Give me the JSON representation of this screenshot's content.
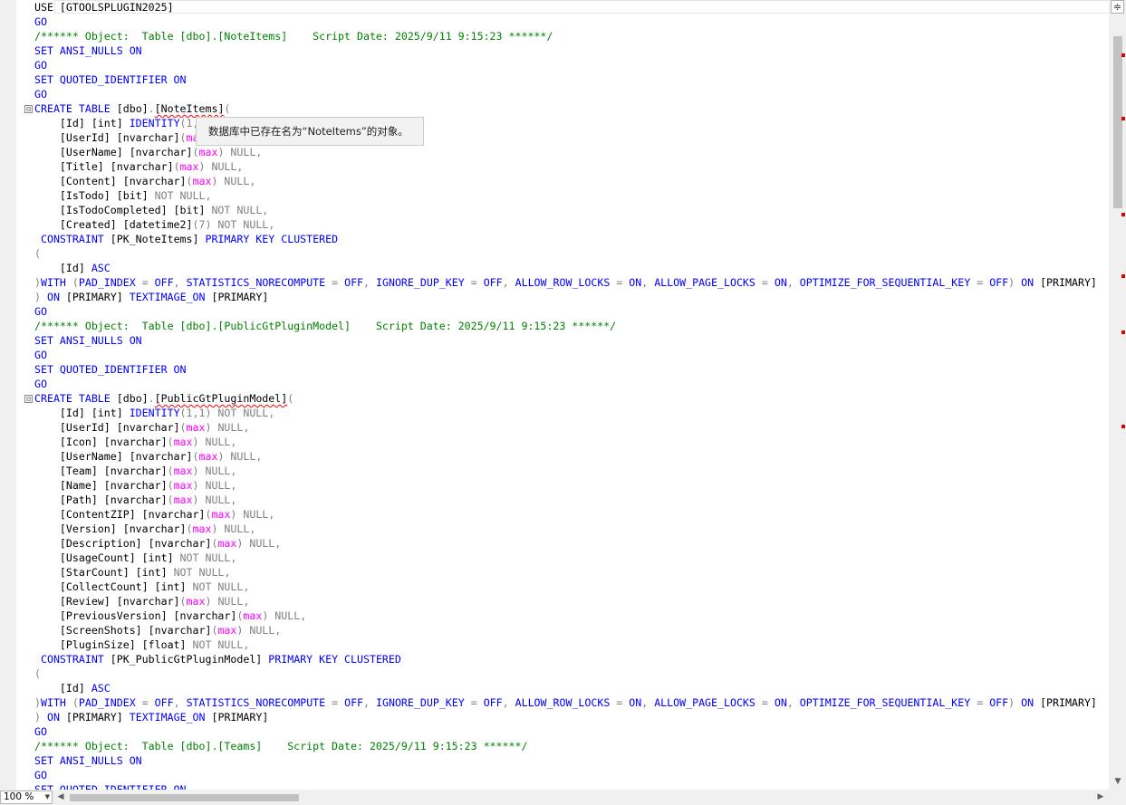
{
  "editor": {
    "lines": [
      [
        {
          "t": "USE [GTOOLSPLUGIN2025]"
        }
      ],
      [
        {
          "t": "GO",
          "c": "kw"
        }
      ],
      [
        {
          "t": "/****** Object:  Table [dbo].[NoteItems]    Script Date: 2025/9/11 9:15:23 ******/",
          "c": "cm"
        }
      ],
      [
        {
          "t": "SET ANSI_NULLS ON",
          "c": "kw"
        }
      ],
      [
        {
          "t": "GO",
          "c": "kw"
        }
      ],
      [
        {
          "t": "SET QUOTED_IDENTIFIER ON",
          "c": "kw"
        }
      ],
      [
        {
          "t": "GO",
          "c": "kw"
        }
      ],
      [
        {
          "t": "CREATE TABLE ",
          "c": "kw"
        },
        {
          "t": "[dbo]"
        },
        {
          "t": ".",
          "c": "gr"
        },
        {
          "t": "[NoteItems]",
          "c": "squig"
        },
        {
          "t": "(",
          "c": "gr"
        }
      ],
      [
        {
          "t": "    [Id] [int] "
        },
        {
          "t": "IDENTITY",
          "c": "kw"
        },
        {
          "t": "(1,",
          "c": "gr"
        }
      ],
      [
        {
          "t": "    [UserId] [nvarchar]"
        },
        {
          "t": "(",
          "c": "gr"
        },
        {
          "t": "max",
          "c": "fn"
        }
      ],
      [
        {
          "t": "    [UserName] [nvarchar]"
        },
        {
          "t": "(",
          "c": "gr"
        },
        {
          "t": "max",
          "c": "fn"
        },
        {
          "t": ") NULL,",
          "c": "gr"
        }
      ],
      [
        {
          "t": "    [Title] [nvarchar]"
        },
        {
          "t": "(",
          "c": "gr"
        },
        {
          "t": "max",
          "c": "fn"
        },
        {
          "t": ") NULL,",
          "c": "gr"
        }
      ],
      [
        {
          "t": "    [Content] [nvarchar]"
        },
        {
          "t": "(",
          "c": "gr"
        },
        {
          "t": "max",
          "c": "fn"
        },
        {
          "t": ") NULL,",
          "c": "gr"
        }
      ],
      [
        {
          "t": "    [IsTodo] [bit] "
        },
        {
          "t": "NOT NULL,",
          "c": "gr"
        }
      ],
      [
        {
          "t": "    [IsTodoCompleted] [bit] "
        },
        {
          "t": "NOT NULL,",
          "c": "gr"
        }
      ],
      [
        {
          "t": "    [Created] [datetime2]"
        },
        {
          "t": "(7) NOT NULL,",
          "c": "gr"
        }
      ],
      [
        {
          "t": " CONSTRAINT ",
          "c": "kw"
        },
        {
          "t": "[PK_NoteItems] "
        },
        {
          "t": "PRIMARY KEY CLUSTERED",
          "c": "kw"
        }
      ],
      [
        {
          "t": "(",
          "c": "gr"
        }
      ],
      [
        {
          "t": "    [Id] "
        },
        {
          "t": "ASC",
          "c": "kw"
        }
      ],
      [
        {
          "t": ")",
          "c": "gr"
        },
        {
          "t": "WITH ",
          "c": "kw"
        },
        {
          "t": "(",
          "c": "gr"
        },
        {
          "t": "PAD_INDEX ",
          "c": "kw"
        },
        {
          "t": "= ",
          "c": "gr"
        },
        {
          "t": "OFF",
          "c": "kw"
        },
        {
          "t": ", ",
          "c": "gr"
        },
        {
          "t": "STATISTICS_NORECOMPUTE ",
          "c": "kw"
        },
        {
          "t": "= ",
          "c": "gr"
        },
        {
          "t": "OFF",
          "c": "kw"
        },
        {
          "t": ", ",
          "c": "gr"
        },
        {
          "t": "IGNORE_DUP_KEY ",
          "c": "kw"
        },
        {
          "t": "= ",
          "c": "gr"
        },
        {
          "t": "OFF",
          "c": "kw"
        },
        {
          "t": ", ",
          "c": "gr"
        },
        {
          "t": "ALLOW_ROW_LOCKS ",
          "c": "kw"
        },
        {
          "t": "= ",
          "c": "gr"
        },
        {
          "t": "ON",
          "c": "kw"
        },
        {
          "t": ", ",
          "c": "gr"
        },
        {
          "t": "ALLOW_PAGE_LOCKS ",
          "c": "kw"
        },
        {
          "t": "= ",
          "c": "gr"
        },
        {
          "t": "ON",
          "c": "kw"
        },
        {
          "t": ", ",
          "c": "gr"
        },
        {
          "t": "OPTIMIZE_FOR_SEQUENTIAL_KEY ",
          "c": "kw"
        },
        {
          "t": "= ",
          "c": "gr"
        },
        {
          "t": "OFF",
          "c": "kw"
        },
        {
          "t": ") ",
          "c": "gr"
        },
        {
          "t": "ON ",
          "c": "kw"
        },
        {
          "t": "[PRIMARY]"
        }
      ],
      [
        {
          "t": ") ",
          "c": "gr"
        },
        {
          "t": "ON ",
          "c": "kw"
        },
        {
          "t": "[PRIMARY] "
        },
        {
          "t": "TEXTIMAGE_ON ",
          "c": "kw"
        },
        {
          "t": "[PRIMARY]"
        }
      ],
      [
        {
          "t": "GO",
          "c": "kw"
        }
      ],
      [
        {
          "t": "/****** Object:  Table [dbo].[PublicGtPluginModel]    Script Date: 2025/9/11 9:15:23 ******/",
          "c": "cm"
        }
      ],
      [
        {
          "t": "SET ANSI_NULLS ON",
          "c": "kw"
        }
      ],
      [
        {
          "t": "GO",
          "c": "kw"
        }
      ],
      [
        {
          "t": "SET QUOTED_IDENTIFIER ON",
          "c": "kw"
        }
      ],
      [
        {
          "t": "GO",
          "c": "kw"
        }
      ],
      [
        {
          "t": "CREATE TABLE ",
          "c": "kw"
        },
        {
          "t": "[dbo]"
        },
        {
          "t": ".",
          "c": "gr"
        },
        {
          "t": "[PublicGtPluginModel]",
          "c": "squig"
        },
        {
          "t": "(",
          "c": "gr"
        }
      ],
      [
        {
          "t": "    [Id] [int] "
        },
        {
          "t": "IDENTITY",
          "c": "kw"
        },
        {
          "t": "(1,1) NOT NULL,",
          "c": "gr"
        }
      ],
      [
        {
          "t": "    [UserId] [nvarchar]"
        },
        {
          "t": "(",
          "c": "gr"
        },
        {
          "t": "max",
          "c": "fn"
        },
        {
          "t": ") NULL,",
          "c": "gr"
        }
      ],
      [
        {
          "t": "    [Icon] [nvarchar]"
        },
        {
          "t": "(",
          "c": "gr"
        },
        {
          "t": "max",
          "c": "fn"
        },
        {
          "t": ") NULL,",
          "c": "gr"
        }
      ],
      [
        {
          "t": "    [UserName] [nvarchar]"
        },
        {
          "t": "(",
          "c": "gr"
        },
        {
          "t": "max",
          "c": "fn"
        },
        {
          "t": ") NULL,",
          "c": "gr"
        }
      ],
      [
        {
          "t": "    [Team] [nvarchar]"
        },
        {
          "t": "(",
          "c": "gr"
        },
        {
          "t": "max",
          "c": "fn"
        },
        {
          "t": ") NULL,",
          "c": "gr"
        }
      ],
      [
        {
          "t": "    [Name] [nvarchar]"
        },
        {
          "t": "(",
          "c": "gr"
        },
        {
          "t": "max",
          "c": "fn"
        },
        {
          "t": ") NULL,",
          "c": "gr"
        }
      ],
      [
        {
          "t": "    [Path] [nvarchar]"
        },
        {
          "t": "(",
          "c": "gr"
        },
        {
          "t": "max",
          "c": "fn"
        },
        {
          "t": ") NULL,",
          "c": "gr"
        }
      ],
      [
        {
          "t": "    [ContentZIP] [nvarchar]"
        },
        {
          "t": "(",
          "c": "gr"
        },
        {
          "t": "max",
          "c": "fn"
        },
        {
          "t": ") NULL,",
          "c": "gr"
        }
      ],
      [
        {
          "t": "    [Version] [nvarchar]"
        },
        {
          "t": "(",
          "c": "gr"
        },
        {
          "t": "max",
          "c": "fn"
        },
        {
          "t": ") NULL,",
          "c": "gr"
        }
      ],
      [
        {
          "t": "    [Description] [nvarchar]"
        },
        {
          "t": "(",
          "c": "gr"
        },
        {
          "t": "max",
          "c": "fn"
        },
        {
          "t": ") NULL,",
          "c": "gr"
        }
      ],
      [
        {
          "t": "    [UsageCount] [int] "
        },
        {
          "t": "NOT NULL,",
          "c": "gr"
        }
      ],
      [
        {
          "t": "    [StarCount] [int] "
        },
        {
          "t": "NOT NULL,",
          "c": "gr"
        }
      ],
      [
        {
          "t": "    [CollectCount] [int] "
        },
        {
          "t": "NOT NULL,",
          "c": "gr"
        }
      ],
      [
        {
          "t": "    [Review] [nvarchar]"
        },
        {
          "t": "(",
          "c": "gr"
        },
        {
          "t": "max",
          "c": "fn"
        },
        {
          "t": ") NULL,",
          "c": "gr"
        }
      ],
      [
        {
          "t": "    [PreviousVersion] [nvarchar]"
        },
        {
          "t": "(",
          "c": "gr"
        },
        {
          "t": "max",
          "c": "fn"
        },
        {
          "t": ") NULL,",
          "c": "gr"
        }
      ],
      [
        {
          "t": "    [ScreenShots] [nvarchar]"
        },
        {
          "t": "(",
          "c": "gr"
        },
        {
          "t": "max",
          "c": "fn"
        },
        {
          "t": ") NULL,",
          "c": "gr"
        }
      ],
      [
        {
          "t": "    [PluginSize] [float] "
        },
        {
          "t": "NOT NULL,",
          "c": "gr"
        }
      ],
      [
        {
          "t": " CONSTRAINT ",
          "c": "kw"
        },
        {
          "t": "[PK_PublicGtPluginModel] "
        },
        {
          "t": "PRIMARY KEY CLUSTERED",
          "c": "kw"
        }
      ],
      [
        {
          "t": "(",
          "c": "gr"
        }
      ],
      [
        {
          "t": "    [Id] "
        },
        {
          "t": "ASC",
          "c": "kw"
        }
      ],
      [
        {
          "t": ")",
          "c": "gr"
        },
        {
          "t": "WITH ",
          "c": "kw"
        },
        {
          "t": "(",
          "c": "gr"
        },
        {
          "t": "PAD_INDEX ",
          "c": "kw"
        },
        {
          "t": "= ",
          "c": "gr"
        },
        {
          "t": "OFF",
          "c": "kw"
        },
        {
          "t": ", ",
          "c": "gr"
        },
        {
          "t": "STATISTICS_NORECOMPUTE ",
          "c": "kw"
        },
        {
          "t": "= ",
          "c": "gr"
        },
        {
          "t": "OFF",
          "c": "kw"
        },
        {
          "t": ", ",
          "c": "gr"
        },
        {
          "t": "IGNORE_DUP_KEY ",
          "c": "kw"
        },
        {
          "t": "= ",
          "c": "gr"
        },
        {
          "t": "OFF",
          "c": "kw"
        },
        {
          "t": ", ",
          "c": "gr"
        },
        {
          "t": "ALLOW_ROW_LOCKS ",
          "c": "kw"
        },
        {
          "t": "= ",
          "c": "gr"
        },
        {
          "t": "ON",
          "c": "kw"
        },
        {
          "t": ", ",
          "c": "gr"
        },
        {
          "t": "ALLOW_PAGE_LOCKS ",
          "c": "kw"
        },
        {
          "t": "= ",
          "c": "gr"
        },
        {
          "t": "ON",
          "c": "kw"
        },
        {
          "t": ", ",
          "c": "gr"
        },
        {
          "t": "OPTIMIZE_FOR_SEQUENTIAL_KEY ",
          "c": "kw"
        },
        {
          "t": "= ",
          "c": "gr"
        },
        {
          "t": "OFF",
          "c": "kw"
        },
        {
          "t": ") ",
          "c": "gr"
        },
        {
          "t": "ON ",
          "c": "kw"
        },
        {
          "t": "[PRIMARY]"
        }
      ],
      [
        {
          "t": ") ",
          "c": "gr"
        },
        {
          "t": "ON ",
          "c": "kw"
        },
        {
          "t": "[PRIMARY] "
        },
        {
          "t": "TEXTIMAGE_ON ",
          "c": "kw"
        },
        {
          "t": "[PRIMARY]"
        }
      ],
      [
        {
          "t": "GO",
          "c": "kw"
        }
      ],
      [
        {
          "t": "/****** Object:  Table [dbo].[Teams]    Script Date: 2025/9/11 9:15:23 ******/",
          "c": "cm"
        }
      ],
      [
        {
          "t": "SET ANSI_NULLS ON",
          "c": "kw"
        }
      ],
      [
        {
          "t": "GO",
          "c": "kw"
        }
      ],
      [
        {
          "t": "SET QUOTED_IDENTIFIER ON",
          "c": "kw"
        }
      ]
    ],
    "fold_markers": [
      "⊟",
      "⊟"
    ]
  },
  "tooltip": {
    "text": "数据库中已存在名为“NoteItems”的对象。"
  },
  "status": {
    "zoom": "100 %"
  },
  "icons": {
    "split": "split-view-icon",
    "scroll_down": "arrow-down-icon",
    "scroll_left": "arrow-left-icon",
    "scroll_right": "arrow-right-icon"
  },
  "colors": {
    "keyword": "#0000ff",
    "comment": "#008000",
    "operator": "#808080",
    "function": "#ff00ff",
    "error": "#ff0000"
  }
}
